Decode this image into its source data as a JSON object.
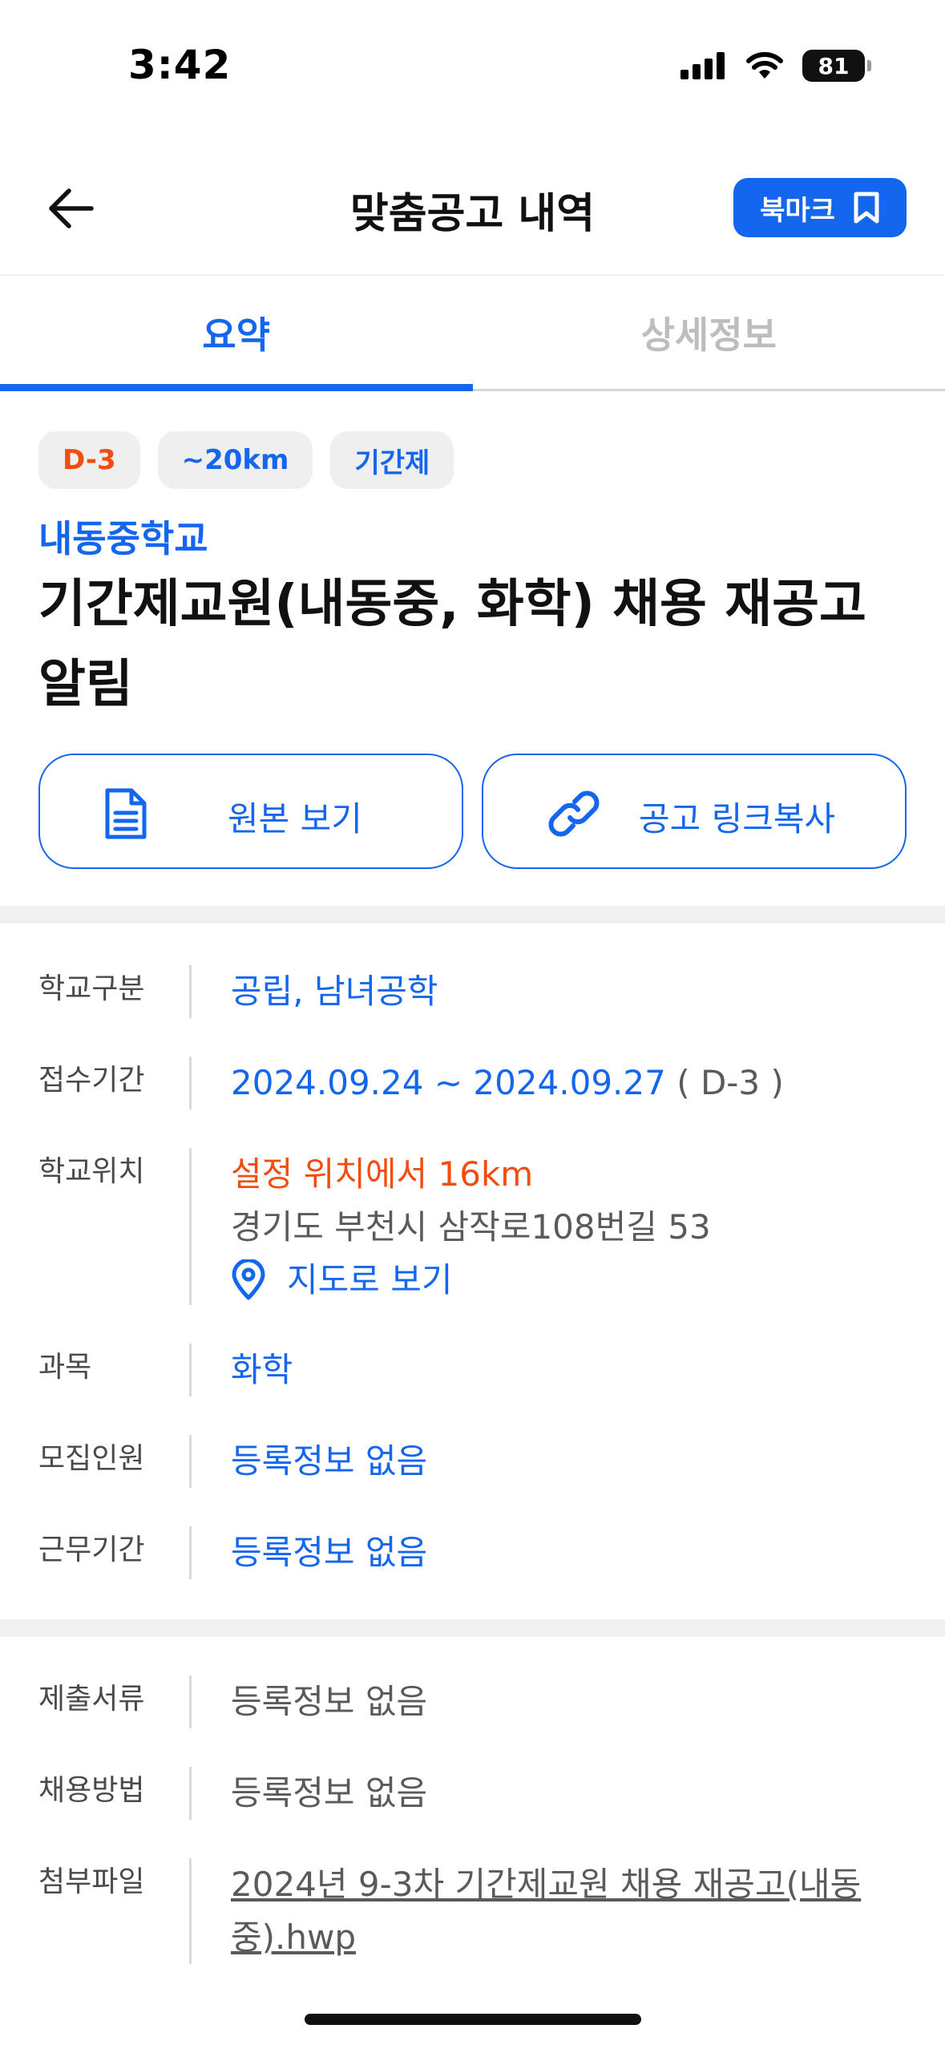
{
  "status_bar": {
    "time": "3:42",
    "battery": "81"
  },
  "nav": {
    "title": "맞춤공고 내역",
    "bookmark_label": "북마크"
  },
  "tabs": [
    {
      "label": "요약",
      "active": true
    },
    {
      "label": "상세정보",
      "active": false
    }
  ],
  "chips": [
    {
      "label": "D-3",
      "color": "#f04d0e"
    },
    {
      "label": "~20km",
      "color": "#1466ee"
    },
    {
      "label": "기간제",
      "color": "#1466ee"
    }
  ],
  "post": {
    "school": "내동중학교",
    "title_line1": "기간제교원(내동중, 화학) 채용 재공고",
    "title_line2": "알림"
  },
  "actions": {
    "view_original": "원본 보기",
    "copy_link": "공고 링크복사"
  },
  "info": {
    "school_type": {
      "label": "학교구분",
      "value": "공립, 남녀공학"
    },
    "period": {
      "label": "접수기간",
      "value": "2024.09.24 ~ 2024.09.27",
      "dday": "( D-3 )"
    },
    "location": {
      "label": "학교위치",
      "distance": "설정 위치에서 16km",
      "address": "경기도 부천시 삼작로108번길 53",
      "map_link": "지도로 보기"
    },
    "subject": {
      "label": "과목",
      "value": "화학"
    },
    "recruits": {
      "label": "모집인원",
      "value": "등록정보 없음"
    },
    "work_period": {
      "label": "근무기간",
      "value": "등록정보 없음"
    },
    "documents": {
      "label": "제출서류",
      "value": "등록정보 없음"
    },
    "method": {
      "label": "채용방법",
      "value": "등록정보 없음"
    },
    "attachment": {
      "label": "첨부파일",
      "value": "2024년 9-3차 기간제교원 채용 재공고(내동중).hwp"
    }
  },
  "colors": {
    "accent": "#1466ee",
    "warning": "#f04d0e",
    "divider": "#f0f0f0"
  }
}
